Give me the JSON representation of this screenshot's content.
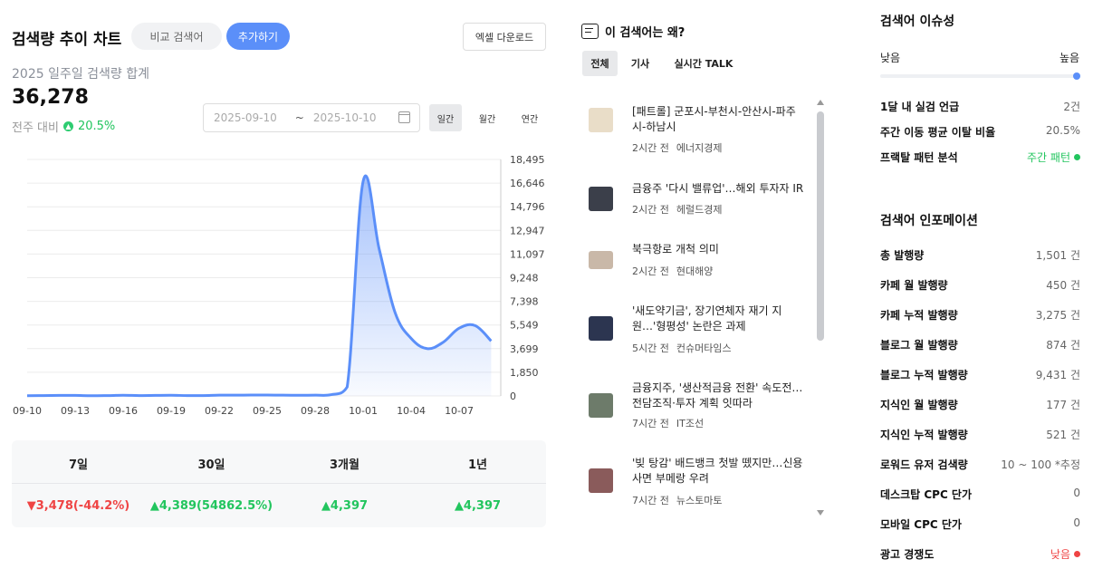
{
  "header": {
    "title": "검색량 추이 차트",
    "compare_button": "비교 검색어",
    "add_button": "추가하기",
    "excel_button": "엑셀 다운로드"
  },
  "summary": {
    "subtitle": "2025 일주일 검색량 합계",
    "total": "36,278",
    "compare_label": "전주 대비",
    "compare_value": "20.5%"
  },
  "date_filter": {
    "start": "2025-09-10",
    "separator": "~",
    "end": "2025-10-10",
    "periods": [
      "일간",
      "월간",
      "연간"
    ],
    "active_period": "일간"
  },
  "chart_data": {
    "type": "area",
    "title": "",
    "xlabel": "",
    "ylabel": "",
    "x_tick_labels": [
      "09-10",
      "09-13",
      "09-16",
      "09-19",
      "09-22",
      "09-25",
      "09-28",
      "10-01",
      "10-04",
      "10-07"
    ],
    "y_tick_labels": [
      "18,495",
      "16,646",
      "14,796",
      "12,947",
      "11,097",
      "9,248",
      "7,398",
      "5,549",
      "3,699",
      "1,850",
      "0"
    ],
    "ylim": [
      0,
      18495
    ],
    "grid": true,
    "color": "#5b8ff9",
    "x": [
      "09-10",
      "09-11",
      "09-12",
      "09-13",
      "09-14",
      "09-15",
      "09-16",
      "09-17",
      "09-18",
      "09-19",
      "09-20",
      "09-21",
      "09-22",
      "09-23",
      "09-24",
      "09-25",
      "09-26",
      "09-27",
      "09-28",
      "09-29",
      "09-30",
      "10-01",
      "10-02",
      "10-03",
      "10-04",
      "10-05",
      "10-06",
      "10-07",
      "10-08",
      "10-09"
    ],
    "values": [
      20,
      30,
      40,
      40,
      20,
      30,
      50,
      30,
      40,
      50,
      30,
      30,
      60,
      60,
      70,
      70,
      60,
      50,
      60,
      100,
      700,
      16800,
      11500,
      6500,
      4500,
      3700,
      4200,
      5300,
      5500,
      4300
    ]
  },
  "period_table": {
    "headers": [
      "7일",
      "30일",
      "3개월",
      "1년"
    ],
    "values": [
      {
        "dir": "down",
        "text": "▼3,478(-44.2%)"
      },
      {
        "dir": "up",
        "text": "▲4,389(54862.5%)"
      },
      {
        "dir": "up",
        "text": "▲4,397"
      },
      {
        "dir": "up",
        "text": "▲4,397"
      }
    ]
  },
  "why": {
    "title": "이 검색어는 왜?",
    "tabs": [
      "전체",
      "기사",
      "실시간 TALK"
    ],
    "active_tab": "전체",
    "news": [
      {
        "headline": "[패트롤] 군포시-부천시-안산시-파주시-하남시",
        "time": "2시간 전",
        "source": "에너지경제",
        "thumb": "#e9ddc8"
      },
      {
        "headline": "금융주 '다시 밸류업'…해외 투자자 IR",
        "time": "2시간 전",
        "source": "헤럴드경제",
        "thumb": "#3b3f4a"
      },
      {
        "headline": "북극항로 개척 의미",
        "time": "2시간 전",
        "source": "현대해양",
        "thumb": "#c9b8a8"
      },
      {
        "headline": "'새도약기금', 장기연체자 재기 지원…'형평성' 논란은 과제",
        "time": "5시간 전",
        "source": "컨슈머타임스",
        "thumb": "#2c3550"
      },
      {
        "headline": "금융지주, '생산적금융 전환' 속도전…전담조직·투자 계획 잇따라",
        "time": "7시간 전",
        "source": "IT조선",
        "thumb": "#6d7b6a"
      },
      {
        "headline": "'빚 탕감' 배드뱅크 첫발 뗐지만…신용사면 부메랑 우려",
        "time": "7시간 전",
        "source": "뉴스토마토",
        "thumb": "#8a5b5b"
      }
    ]
  },
  "issue": {
    "title": "검색어 이슈성",
    "low_label": "낮음",
    "high_label": "높음",
    "level": 1.0,
    "rows": [
      {
        "label": "1달 내 실검 언급",
        "value": "2건"
      },
      {
        "label": "주간 이동 평균 이탈 비율",
        "value": "20.5%"
      },
      {
        "label": "프랙탈 패턴 분석",
        "value": "주간 패턴",
        "status": "green"
      }
    ]
  },
  "info": {
    "title": "검색어 인포메이션",
    "rows": [
      {
        "label": "총 발행량",
        "value": "1,501 건"
      },
      {
        "label": "카페 월 발행량",
        "value": "450 건"
      },
      {
        "label": "카페 누적 발행량",
        "value": "3,275 건"
      },
      {
        "label": "블로그 월 발행량",
        "value": "874 건"
      },
      {
        "label": "블로그 누적 발행량",
        "value": "9,431 건"
      },
      {
        "label": "지식인 월 발행량",
        "value": "177 건"
      },
      {
        "label": "지식인 누적 발행량",
        "value": "521 건"
      },
      {
        "label": "로워드 유저 검색량",
        "value": "10 ~ 100 *추정"
      },
      {
        "label": "데스크탑 CPC 단가",
        "value": "0"
      },
      {
        "label": "모바일 CPC 단가",
        "value": "0"
      },
      {
        "label": "광고 경쟁도",
        "value": "낮음",
        "status": "red"
      }
    ]
  }
}
